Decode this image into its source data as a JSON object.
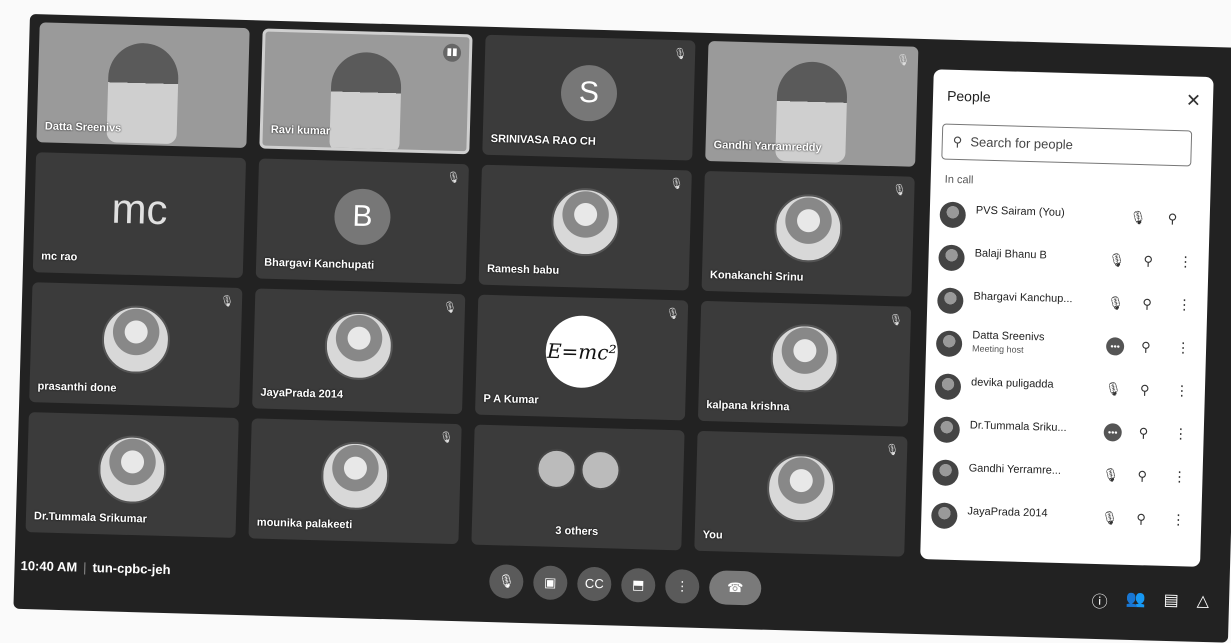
{
  "tiles": [
    {
      "name": "Datta Sreenivs",
      "kind": "video"
    },
    {
      "name": "Ravi kumar",
      "kind": "video-active"
    },
    {
      "name": "SRINIVASA RAO CH",
      "kind": "letter",
      "letter": "S"
    },
    {
      "name": "Gandhi Yarramreddy",
      "kind": "video"
    },
    {
      "name": "mc rao",
      "kind": "initials",
      "letter": "mc"
    },
    {
      "name": "Bhargavi Kanchupati",
      "kind": "letter",
      "letter": "B"
    },
    {
      "name": "Ramesh babu",
      "kind": "photo"
    },
    {
      "name": "Konakanchi Srinu",
      "kind": "photo"
    },
    {
      "name": "prasanthi done",
      "kind": "photo"
    },
    {
      "name": "JayaPrada 2014",
      "kind": "photo"
    },
    {
      "name": "P A Kumar",
      "kind": "eq",
      "letter": "E=mc²"
    },
    {
      "name": "kalpana krishna",
      "kind": "photo"
    },
    {
      "name": "Dr.Tummala Srikumar",
      "kind": "photo"
    },
    {
      "name": "mounika palakeeti",
      "kind": "photo"
    },
    {
      "name": "3 others",
      "kind": "group"
    },
    {
      "name": "You",
      "kind": "photo"
    }
  ],
  "meeting": {
    "time": "10:40 AM",
    "code": "tun-cpbc-jeh",
    "separator": "|"
  },
  "controls": {
    "mic": "mic-off",
    "camera": "camera-off",
    "captions": "CC",
    "present": "present",
    "more": "⋮",
    "leave": "leave"
  },
  "people_panel": {
    "title": "People",
    "search_placeholder": "Search for people",
    "section": "In call",
    "rows": [
      {
        "name": "PVS Sairam (You)",
        "sub": ""
      },
      {
        "name": "Balaji Bhanu B",
        "sub": ""
      },
      {
        "name": "Bhargavi Kanchup...",
        "sub": ""
      },
      {
        "name": "Datta Sreenivs",
        "sub": "Meeting host"
      },
      {
        "name": "devika puligadda",
        "sub": ""
      },
      {
        "name": "Dr.Tummala Sriku...",
        "sub": ""
      },
      {
        "name": "Gandhi Yerramre...",
        "sub": ""
      },
      {
        "name": "JayaPrada 2014",
        "sub": ""
      }
    ]
  }
}
